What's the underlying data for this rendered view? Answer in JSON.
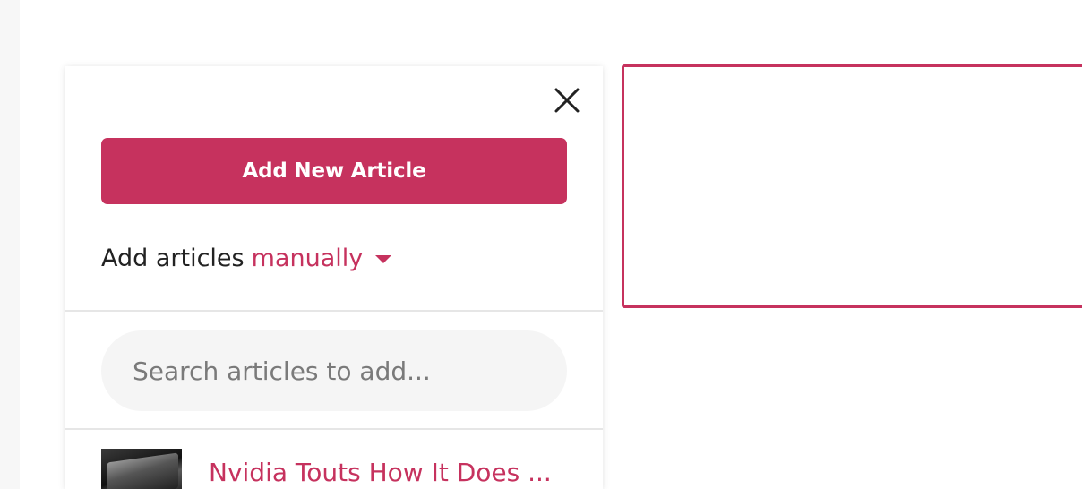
{
  "panel": {
    "add_button_label": "Add New Article",
    "mode_prefix": "Add articles",
    "mode_value": "manually",
    "search": {
      "placeholder": "Search articles to add...",
      "value": ""
    },
    "articles": [
      {
        "title": "Nvidia Touts How It Does ..."
      }
    ]
  },
  "colors": {
    "accent": "#c6325e",
    "search_bg": "#f5f5f5",
    "divider": "#e6e6e6"
  },
  "icons": {
    "close": "close-icon",
    "dropdown": "caret-down-icon"
  }
}
